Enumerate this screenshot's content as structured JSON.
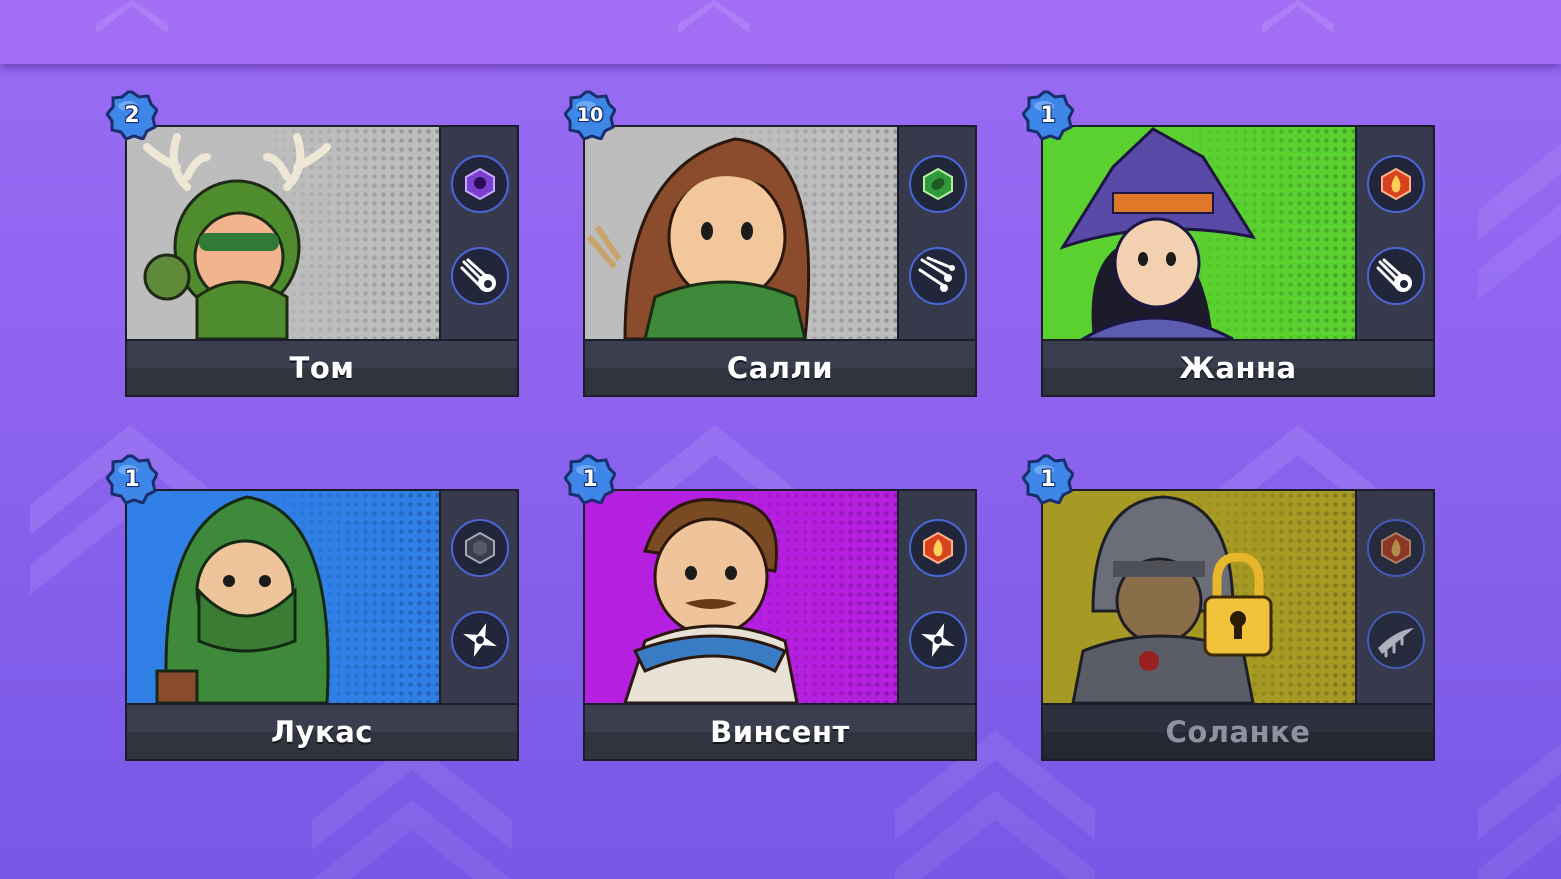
{
  "colors": {
    "background": "#8f64ef",
    "card_panel": "#363a4c",
    "badge": "#3e86e8",
    "icon_ring": "#4b67d8"
  },
  "heroes": [
    {
      "name": "Том",
      "level": "2",
      "portrait_bg": "#bdbdbd",
      "element_icon": "dark-skull-gem-icon",
      "skill_icon": "comet-icon",
      "locked": false
    },
    {
      "name": "Салли",
      "level": "10",
      "portrait_bg": "#bdbdbd",
      "element_icon": "nature-leaf-gem-icon",
      "skill_icon": "arrow-volley-icon",
      "locked": false
    },
    {
      "name": "Жанна",
      "level": "1",
      "portrait_bg": "#5bd130",
      "element_icon": "fire-gem-icon",
      "skill_icon": "comet-icon",
      "locked": false
    },
    {
      "name": "Лукас",
      "level": "1",
      "portrait_bg": "#2f7fe6",
      "element_icon": "neutral-gem-icon",
      "skill_icon": "shuriken-icon",
      "locked": false
    },
    {
      "name": "Винсент",
      "level": "1",
      "portrait_bg": "#b51fe0",
      "element_icon": "fire-gem-icon",
      "skill_icon": "shuriken-icon",
      "locked": false
    },
    {
      "name": "Соланке",
      "level": "1",
      "portrait_bg": "#a69a24",
      "element_icon": "fire-gem-icon",
      "skill_icon": "blade-slash-icon",
      "locked": true
    }
  ]
}
